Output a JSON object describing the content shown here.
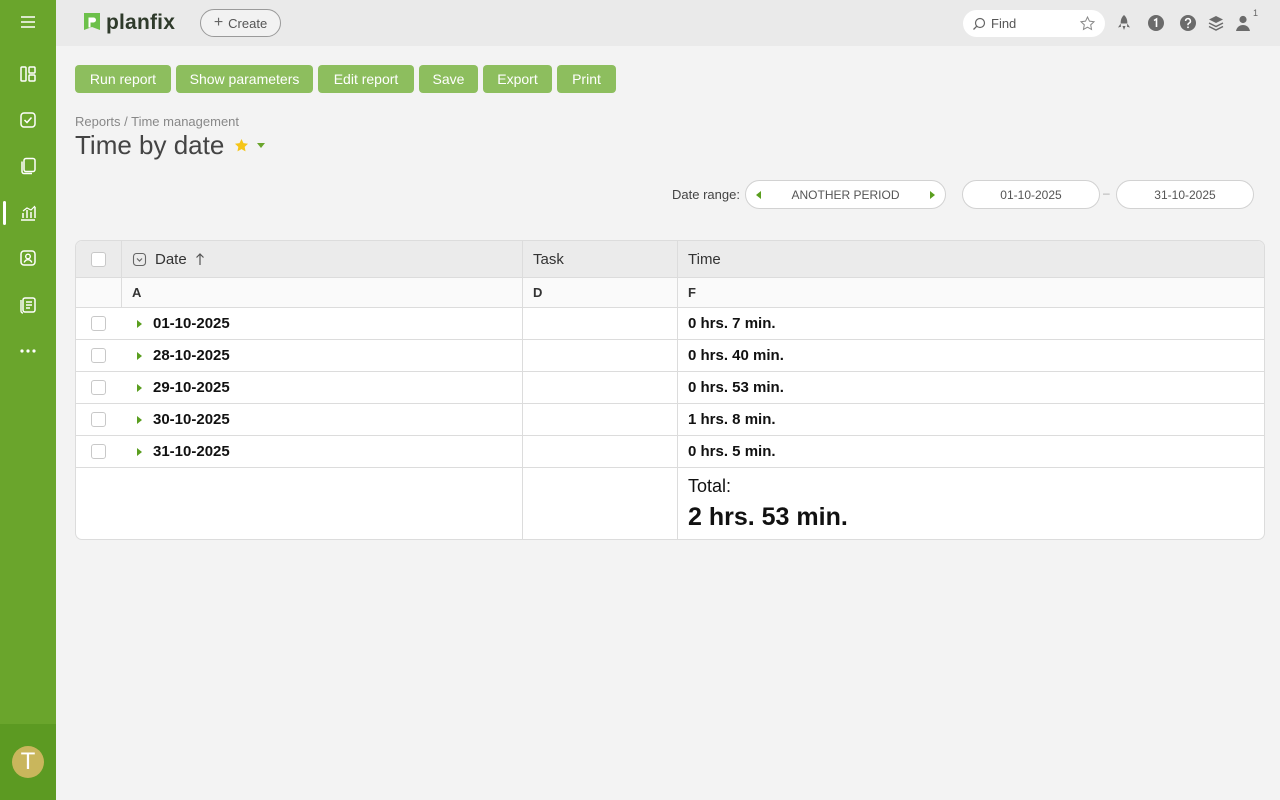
{
  "app": {
    "logo_text": "planfix",
    "create_label": "Create",
    "search_placeholder": "Find",
    "notification_count": "1",
    "user_initial": "T",
    "accent_color": "#6aa52c"
  },
  "sidebar": {
    "items": [
      {
        "name": "menu",
        "icon": "hamburger-icon"
      },
      {
        "name": "dashboards",
        "icon": "dashboard-icon"
      },
      {
        "name": "tasks",
        "icon": "task-check-icon"
      },
      {
        "name": "documents",
        "icon": "documents-icon"
      },
      {
        "name": "reports",
        "icon": "reports-chart-icon",
        "active": true
      },
      {
        "name": "contacts",
        "icon": "contacts-icon"
      },
      {
        "name": "directories",
        "icon": "directory-list-icon"
      },
      {
        "name": "more",
        "icon": "more-dots-icon"
      }
    ]
  },
  "toolbar": {
    "run_report": "Run report",
    "show_parameters": "Show parameters",
    "edit_report": "Edit report",
    "save": "Save",
    "export": "Export",
    "print": "Print"
  },
  "breadcrumb": "Reports / Time management",
  "page_title": "Time by date",
  "date_range": {
    "label": "Date range:",
    "period": "ANOTHER PERIOD",
    "from": "01-10-2025",
    "separator": "–",
    "to": "31-10-2025"
  },
  "table": {
    "headers": {
      "date": "Date",
      "task": "Task",
      "time": "Time"
    },
    "column_letters": {
      "date": "A",
      "task": "D",
      "time": "F"
    },
    "rows": [
      {
        "date": "01-10-2025",
        "task": "",
        "time": "0 hrs. 7 min."
      },
      {
        "date": "28-10-2025",
        "task": "",
        "time": "0 hrs. 40 min."
      },
      {
        "date": "29-10-2025",
        "task": "",
        "time": "0 hrs. 53 min."
      },
      {
        "date": "30-10-2025",
        "task": "",
        "time": "1 hrs. 8 min."
      },
      {
        "date": "31-10-2025",
        "task": "",
        "time": "0 hrs. 5 min."
      }
    ],
    "total_label": "Total:",
    "total_value": "2 hrs. 53 min."
  }
}
